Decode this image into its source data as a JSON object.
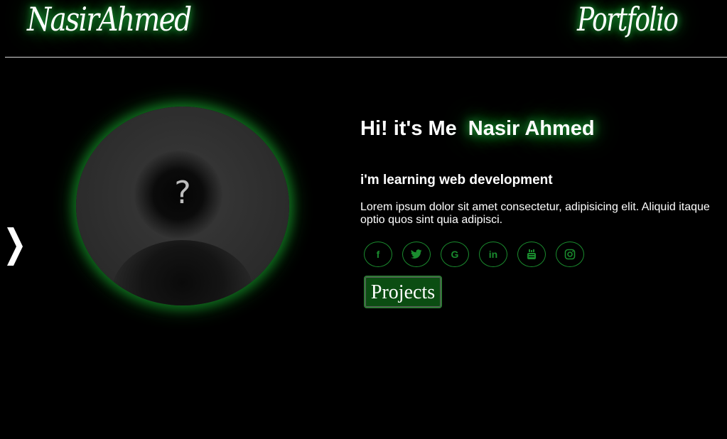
{
  "header": {
    "brand": "NasirAhmed",
    "nav_title": "Portfolio"
  },
  "hero": {
    "greeting_prefix": "Hi! it's Me",
    "name": "Nasir Ahmed",
    "tagline": "i'm learning web development",
    "intro": "Lorem ipsum dolor sit amet consectetur, adipisicing elit. Aliquid itaque optio quos sint quia adipisci.",
    "avatar_placeholder": "?"
  },
  "socials": [
    {
      "icon": "facebook-icon",
      "glyph": "f"
    },
    {
      "icon": "twitter-icon",
      "glyph": ""
    },
    {
      "icon": "google-icon",
      "glyph": "G"
    },
    {
      "icon": "linkedin-icon",
      "glyph": "in"
    },
    {
      "icon": "youtube-icon",
      "glyph": ""
    },
    {
      "icon": "instagram-icon",
      "glyph": ""
    }
  ],
  "buttons": {
    "projects": "Projects"
  },
  "colors": {
    "background": "#000000",
    "glow": "#1fa83a",
    "social_outline": "#1a8c2e",
    "button_bg": "#0b4d12"
  }
}
